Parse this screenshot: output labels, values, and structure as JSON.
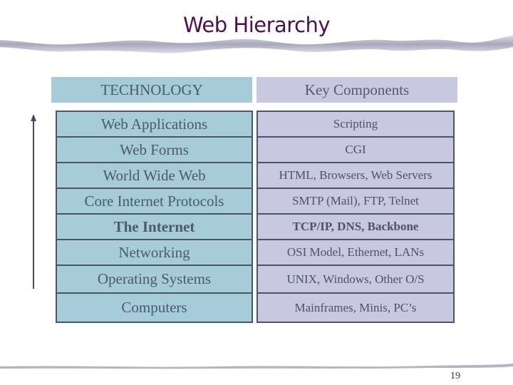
{
  "slide": {
    "title": "Web Hierarchy",
    "page_number": "19"
  },
  "table": {
    "headers": {
      "technology": "TECHNOLOGY",
      "key_components": "Key Components"
    },
    "rows": [
      {
        "technology": "Web Applications",
        "components": "Scripting",
        "bold": false
      },
      {
        "technology": "Web Forms",
        "components": "CGI",
        "bold": false
      },
      {
        "technology": "World Wide Web",
        "components": "HTML, Browsers, Web Servers",
        "bold": false
      },
      {
        "technology": "Core Internet Protocols",
        "components": "SMTP (Mail), FTP, Telnet",
        "bold": false
      },
      {
        "technology": "The Internet",
        "components": "TCP/IP, DNS, Backbone",
        "bold": true
      },
      {
        "technology": "Networking",
        "components": "OSI Model, Ethernet, LANs",
        "bold": false
      },
      {
        "technology": "Operating Systems",
        "components": "UNIX, Windows, Other O/S",
        "bold": false
      },
      {
        "technology": "Computers",
        "components": "Mainframes, Minis, PC’s",
        "bold": false
      }
    ]
  },
  "icons": {
    "arrow": "up-arrow-icon"
  },
  "colors": {
    "title": "#4a1150",
    "technology_fill": "#a6cbd9",
    "components_fill": "#c8c8e0",
    "border": "#4a5568",
    "text": "#4a5a70"
  }
}
